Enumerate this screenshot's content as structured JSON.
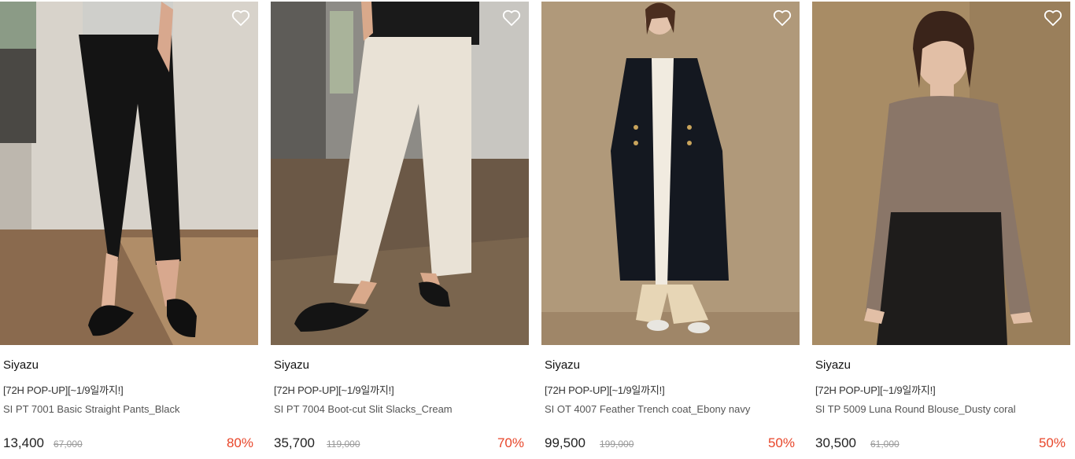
{
  "colors": {
    "discount": "#e8462a",
    "heart": "#ffffff"
  },
  "products": [
    {
      "brand": "Siyazu",
      "promo": "[72H POP-UP][~1/9일까지!]",
      "name": "SI PT 7001 Basic Straight Pants_Black",
      "price": "13,400",
      "original_price": "67,000",
      "discount": "80%",
      "wishlist_icon": "heart-outline-icon"
    },
    {
      "brand": "Siyazu",
      "promo": "[72H POP-UP][~1/9일까지!]",
      "name": "SI PT 7004 Boot-cut Slit Slacks_Cream",
      "price": "35,700",
      "original_price": "119,000",
      "discount": "70%",
      "wishlist_icon": "heart-outline-icon"
    },
    {
      "brand": "Siyazu",
      "promo": "[72H POP-UP][~1/9일까지!]",
      "name": "SI OT 4007 Feather Trench coat_Ebony navy",
      "price": "99,500",
      "original_price": "199,000",
      "discount": "50%",
      "wishlist_icon": "heart-outline-icon"
    },
    {
      "brand": "Siyazu",
      "promo": "[72H POP-UP][~1/9일까지!]",
      "name": "SI TP 5009 Luna Round Blouse_Dusty coral",
      "price": "30,500",
      "original_price": "61,000",
      "discount": "50%",
      "wishlist_icon": "heart-outline-icon"
    }
  ]
}
